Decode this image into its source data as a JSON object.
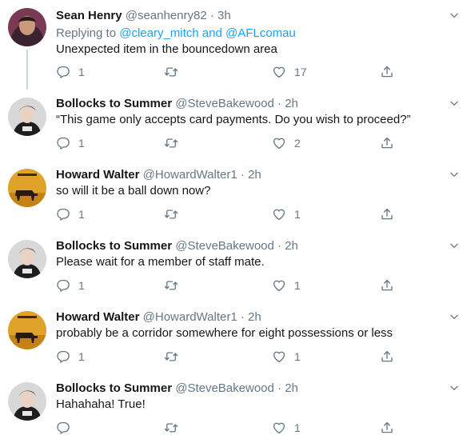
{
  "tweets": [
    {
      "name": "Sean Henry",
      "handle": "@seanhenry82",
      "sep": "·",
      "time": "3h",
      "replying_prefix": "Replying to",
      "replying_links": "@cleary_mitch and @AFLcomau",
      "text": "Unexpected item in the bouncedown area",
      "reply_count": "1",
      "retweet_count": "",
      "like_count": "17"
    },
    {
      "name": "Bollocks to Summer",
      "handle": "@SteveBakewood",
      "sep": "·",
      "time": "2h",
      "text": "“This game only accepts card payments. Do you wish to proceed?”",
      "reply_count": "1",
      "retweet_count": "",
      "like_count": "2"
    },
    {
      "name": "Howard Walter",
      "handle": "@HowardWalter1",
      "sep": "·",
      "time": "2h",
      "text": "so will it be a ball down now?",
      "reply_count": "1",
      "retweet_count": "",
      "like_count": "1"
    },
    {
      "name": "Bollocks to Summer",
      "handle": "@SteveBakewood",
      "sep": "·",
      "time": "2h",
      "text": "Please wait for a member of staff mate.",
      "reply_count": "1",
      "retweet_count": "",
      "like_count": "1"
    },
    {
      "name": "Howard Walter",
      "handle": "@HowardWalter1",
      "sep": "·",
      "time": "2h",
      "text": "probably be a corridor somewhere for eight possessions or less",
      "reply_count": "1",
      "retweet_count": "",
      "like_count": "1"
    },
    {
      "name": "Bollocks to Summer",
      "handle": "@SteveBakewood",
      "sep": "·",
      "time": "2h",
      "text": "Hahahaha! True!",
      "reply_count": "",
      "retweet_count": "",
      "like_count": "1"
    }
  ],
  "colors": {
    "text": "#14171a",
    "secondary": "#657786",
    "link": "#1da1f2",
    "thread_line": "#ccd6dd"
  },
  "icons": [
    "reply-icon",
    "retweet-icon",
    "like-icon",
    "share-icon",
    "chevron-down-icon"
  ]
}
